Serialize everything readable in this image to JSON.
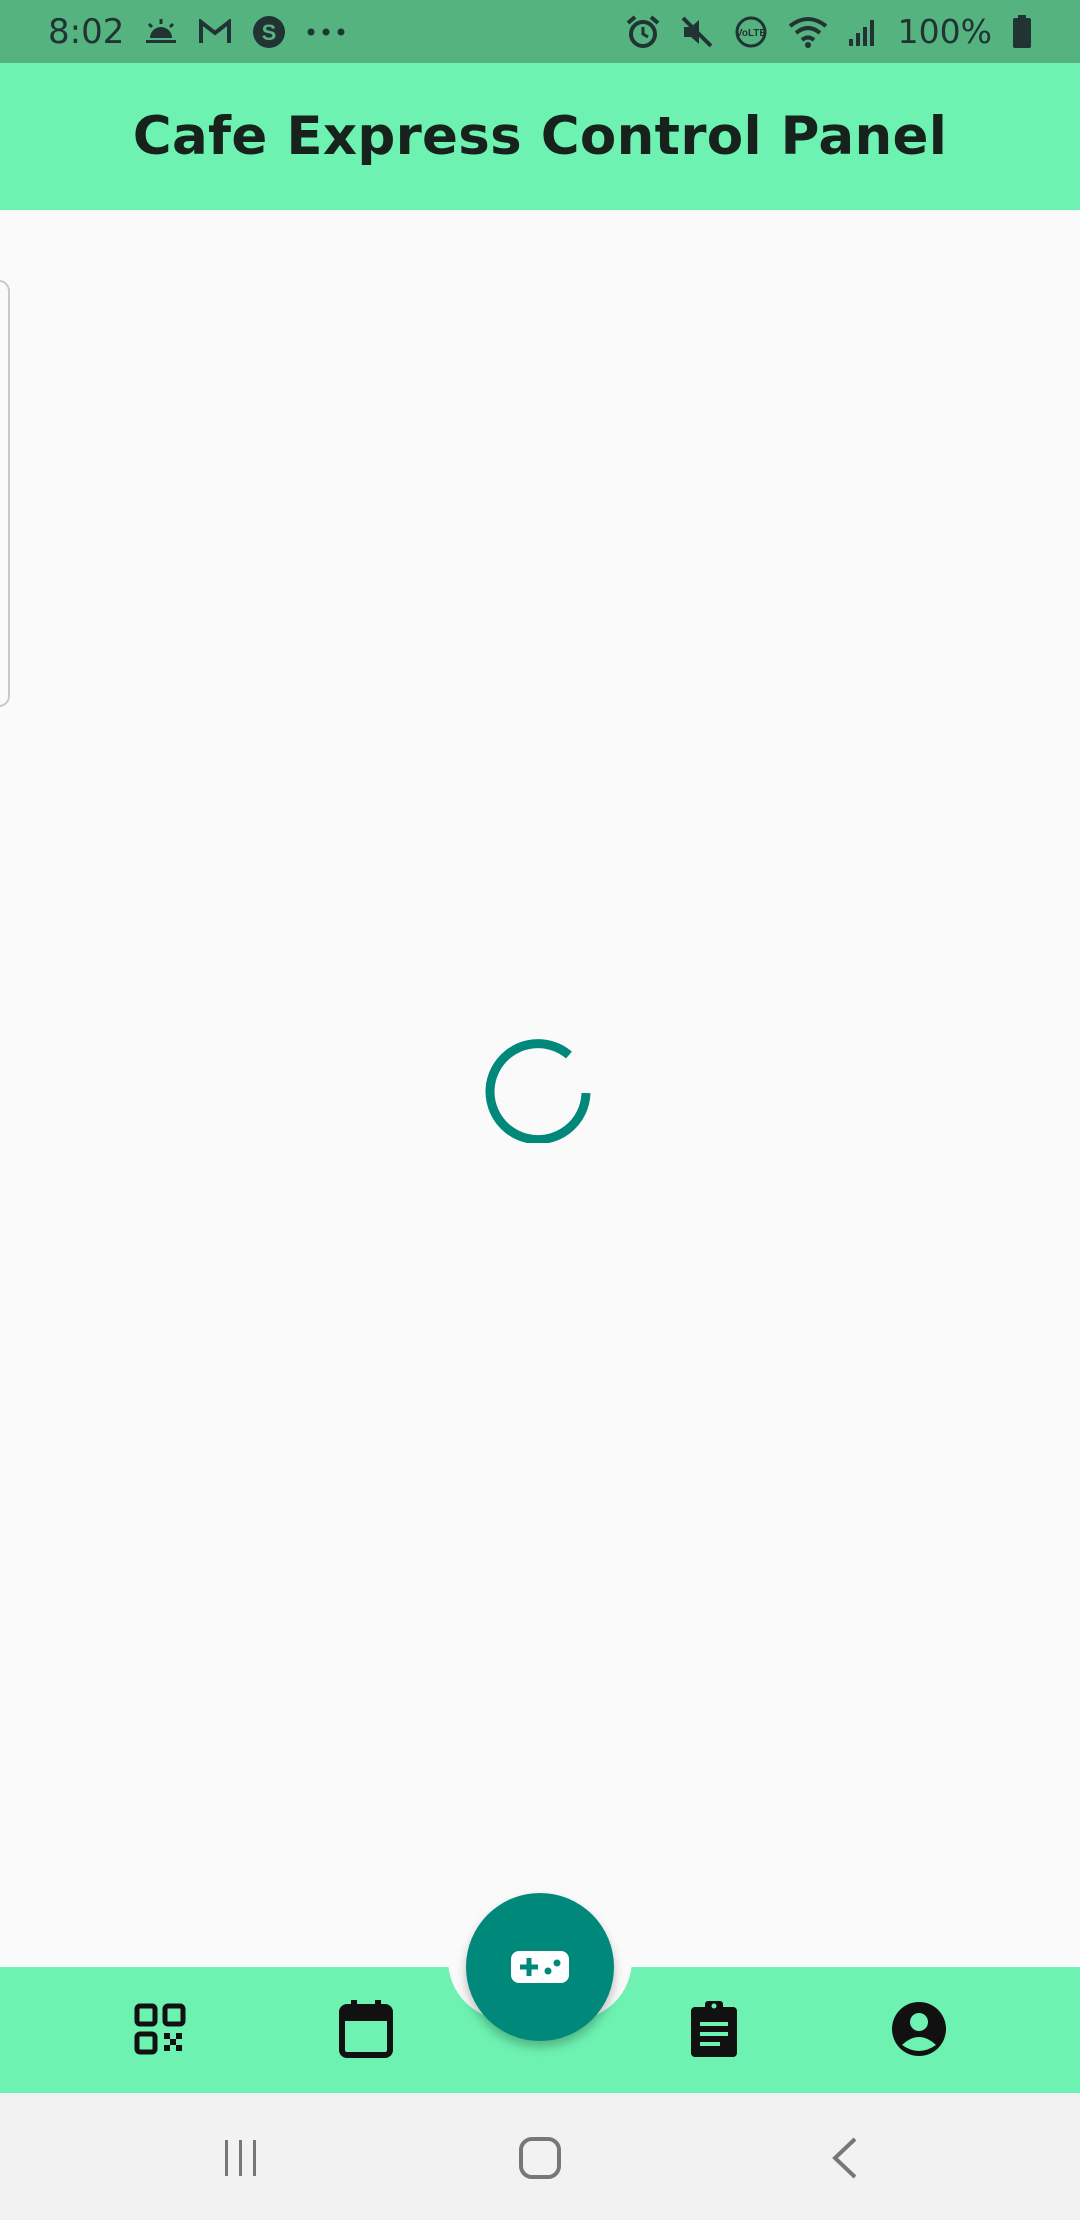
{
  "status_bar": {
    "time": "8:02",
    "left_icons": [
      "weather-icon",
      "gmail-icon",
      "skype-icon",
      "more-dots-icon"
    ],
    "right_icons": [
      "alarm-icon",
      "mute-icon",
      "volte-icon",
      "wifi-icon",
      "signal-icon",
      "battery-icon"
    ],
    "battery": "100%",
    "volte_label": "VoLTE"
  },
  "app_bar": {
    "title": "Cafe Express Control Panel",
    "color": "#6df2b1"
  },
  "content": {
    "state": "loading",
    "spinner_color": "#00897b"
  },
  "bottom_nav": {
    "items": [
      {
        "icon": "qr-code-icon"
      },
      {
        "icon": "calendar-icon"
      },
      {
        "icon": "clipboard-icon"
      },
      {
        "icon": "account-circle-icon"
      }
    ],
    "fab": {
      "icon": "gamepad-icon",
      "color": "#00897b"
    }
  },
  "system_nav": {
    "buttons": [
      "recents-icon",
      "home-icon",
      "back-icon"
    ]
  }
}
